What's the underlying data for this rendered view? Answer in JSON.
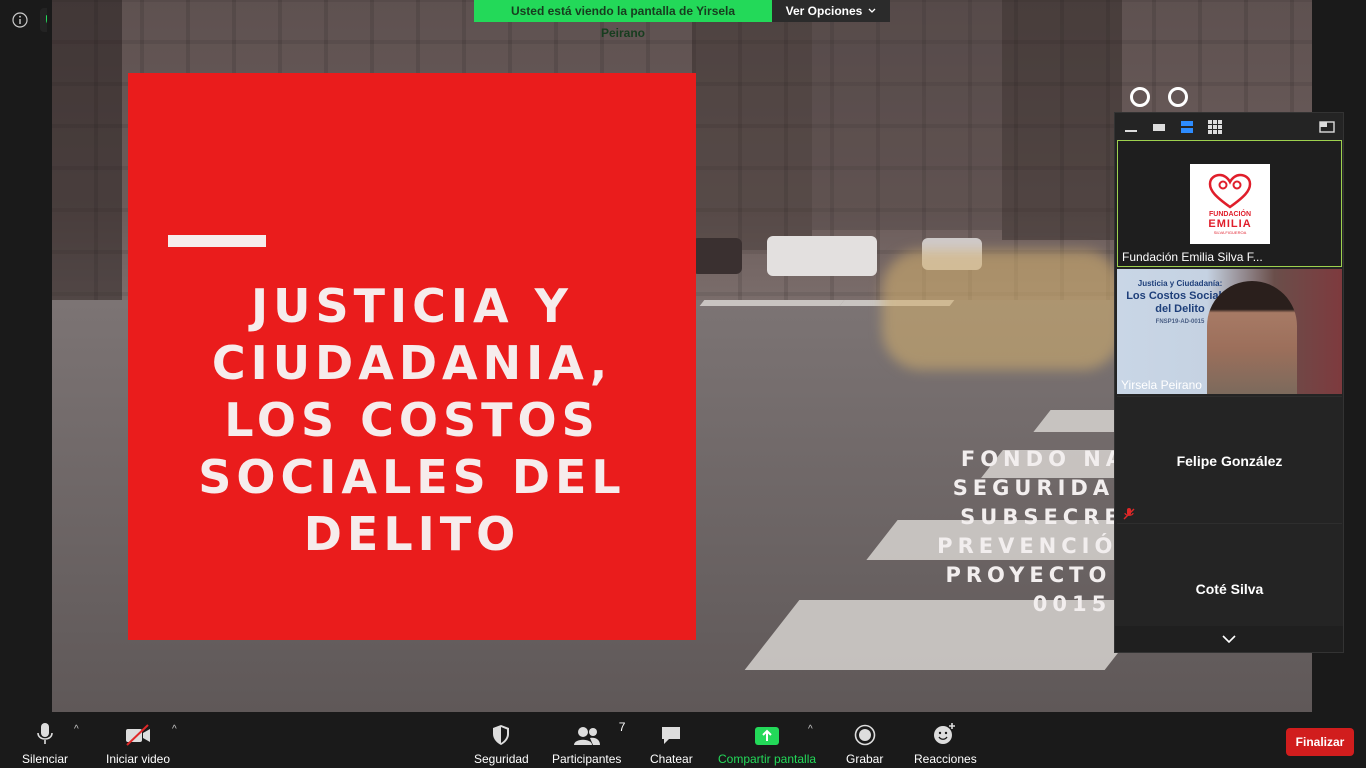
{
  "banner": {
    "text": "Usted está viendo la pantalla de Yirsela Peirano",
    "options_label": "Ver Opciones"
  },
  "slide": {
    "title": "JUSTICIA Y CIUDADANIA, LOS COSTOS SOCIALES DEL DELITO",
    "fondo_lines": [
      "FONDO NACIO",
      "SEGURIDAD PÚ",
      "SUBSECRETAR",
      "PREVENCIÓN DEI",
      "PROYECTO FNSI",
      "0015"
    ]
  },
  "participants": {
    "tiles": [
      {
        "name": "Fundación Emilia Silva F..."
      },
      {
        "name": "Yirsela Peirano"
      },
      {
        "name": "Felipe González"
      },
      {
        "name": "Coté Silva"
      }
    ],
    "logo": {
      "line1": "FUNDACIÓN",
      "line2": "EMILIA",
      "line3": "SILVA FIGUEROA"
    },
    "yirsela_slide": {
      "line1": "Justicia y Ciudadanía:",
      "line2": "Los Costos Sociales",
      "line3": "del Delito",
      "line4": "FNSP19-AD-0015"
    }
  },
  "toolbar": {
    "mute_label": "Silenciar",
    "video_label": "Iniciar video",
    "security_label": "Seguridad",
    "participants_label": "Participantes",
    "participants_count": "7",
    "chat_label": "Chatear",
    "share_label": "Compartir pantalla",
    "record_label": "Grabar",
    "reactions_label": "Reacciones",
    "end_label": "Finalizar"
  },
  "colors": {
    "share_green": "#23d959",
    "end_red": "#d11d1d",
    "slide_red": "#ea1c1c"
  }
}
